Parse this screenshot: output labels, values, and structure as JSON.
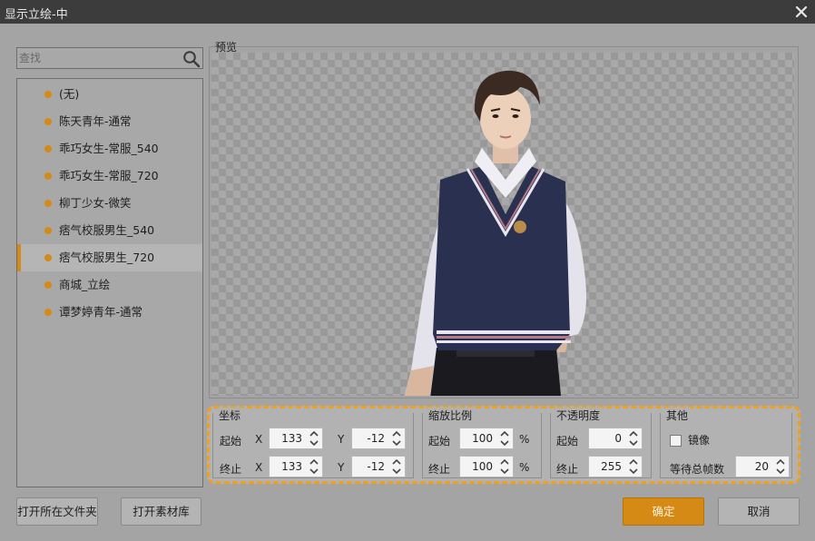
{
  "window": {
    "title": "显示立绘-中"
  },
  "search": {
    "placeholder": "查找"
  },
  "list": {
    "items": [
      {
        "label": "(无)"
      },
      {
        "label": "陈天青年-通常"
      },
      {
        "label": "乖巧女生-常服_540"
      },
      {
        "label": "乖巧女生-常服_720"
      },
      {
        "label": "柳丁少女-微笑"
      },
      {
        "label": "痞气校服男生_540"
      },
      {
        "label": "痞气校服男生_720"
      },
      {
        "label": "商城_立绘"
      },
      {
        "label": "谭梦婷青年-通常"
      }
    ],
    "selected_index": 6
  },
  "preview": {
    "legend": "预览"
  },
  "coords": {
    "title": "坐标",
    "start_label": "起始",
    "end_label": "终止",
    "x_label": "X",
    "y_label": "Y",
    "start_x": "133",
    "start_y": "-12",
    "end_x": "133",
    "end_y": "-12"
  },
  "scale": {
    "title": "缩放比例",
    "start_label": "起始",
    "end_label": "终止",
    "start_value": "100",
    "end_value": "100",
    "unit": "%"
  },
  "opacity": {
    "title": "不透明度",
    "start_label": "起始",
    "end_label": "终止",
    "start_value": "0",
    "end_value": "255"
  },
  "other": {
    "title": "其他",
    "mirror_label": "镜像",
    "mirror_checked": false,
    "wait_label": "等待总帧数",
    "wait_value": "20"
  },
  "buttons": {
    "open_folder": "打开所在文件夹",
    "open_library": "打开素材库",
    "ok": "确定",
    "cancel": "取消"
  },
  "colors": {
    "accent": "#d48a14",
    "titlebar": "#3c3c3c",
    "background": "#a4a4a4"
  }
}
